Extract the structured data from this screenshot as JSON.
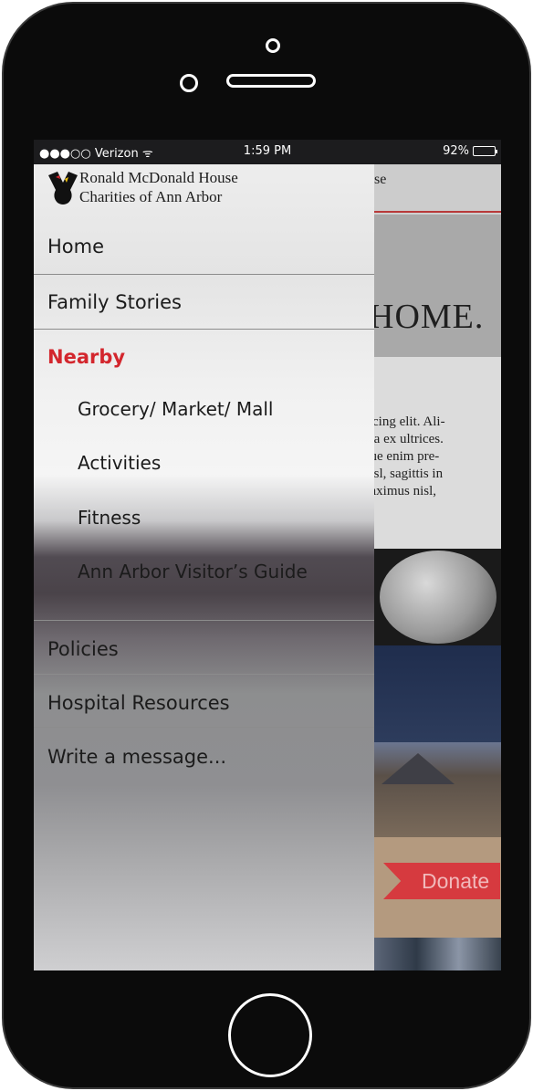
{
  "status_bar": {
    "carrier": "●●●○○ Verizon ᯤ",
    "time": "1:59 PM",
    "battery": "92%",
    "battery_level": 0.92
  },
  "drawer": {
    "org_name_line1": "Ronald McDonald House",
    "org_name_line2": "Charities of Ann Arbor",
    "items": [
      {
        "label": "Home"
      },
      {
        "label": "Family Stories"
      },
      {
        "label": "Nearby"
      },
      {
        "label": "Grocery/ Market/ Mall"
      },
      {
        "label": "Activities"
      },
      {
        "label": "Fitness"
      },
      {
        "label": "Ann Arbor Visitor’s Guide"
      },
      {
        "label": "Policies"
      },
      {
        "label": "Hospital Resources"
      },
      {
        "label": "Write a message..."
      }
    ]
  },
  "background_page": {
    "header_fragment": "se",
    "hero_fragment": "HOME.",
    "body_lines": [
      "iscing elit. Ali-",
      "nia ex ultrices.",
      "que enim pre-",
      "nisl, sagittis in",
      "naximus nisl,"
    ],
    "donate_label": "Donate"
  },
  "colors": {
    "accent_red": "#d3262d",
    "donate_red": "#d63a3f"
  }
}
